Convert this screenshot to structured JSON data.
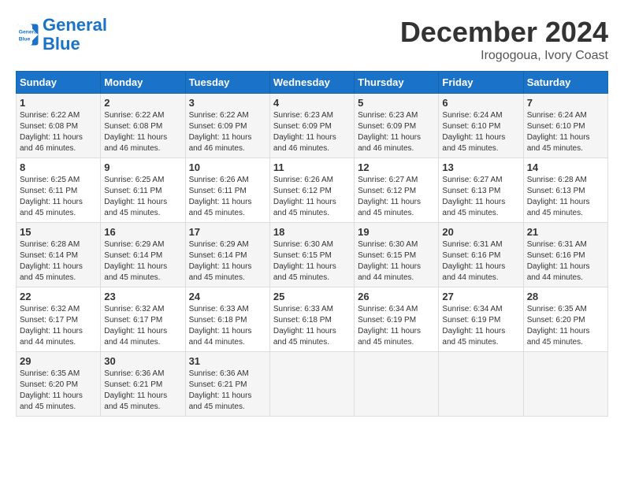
{
  "logo": {
    "line1": "General",
    "line2": "Blue"
  },
  "header": {
    "month": "December 2024",
    "location": "Irogogoua, Ivory Coast"
  },
  "weekdays": [
    "Sunday",
    "Monday",
    "Tuesday",
    "Wednesday",
    "Thursday",
    "Friday",
    "Saturday"
  ],
  "weeks": [
    [
      {
        "day": "1",
        "sunrise": "6:22 AM",
        "sunset": "6:08 PM",
        "daylight": "11 hours and 46 minutes."
      },
      {
        "day": "2",
        "sunrise": "6:22 AM",
        "sunset": "6:08 PM",
        "daylight": "11 hours and 46 minutes."
      },
      {
        "day": "3",
        "sunrise": "6:22 AM",
        "sunset": "6:09 PM",
        "daylight": "11 hours and 46 minutes."
      },
      {
        "day": "4",
        "sunrise": "6:23 AM",
        "sunset": "6:09 PM",
        "daylight": "11 hours and 46 minutes."
      },
      {
        "day": "5",
        "sunrise": "6:23 AM",
        "sunset": "6:09 PM",
        "daylight": "11 hours and 46 minutes."
      },
      {
        "day": "6",
        "sunrise": "6:24 AM",
        "sunset": "6:10 PM",
        "daylight": "11 hours and 45 minutes."
      },
      {
        "day": "7",
        "sunrise": "6:24 AM",
        "sunset": "6:10 PM",
        "daylight": "11 hours and 45 minutes."
      }
    ],
    [
      {
        "day": "8",
        "sunrise": "6:25 AM",
        "sunset": "6:11 PM",
        "daylight": "11 hours and 45 minutes."
      },
      {
        "day": "9",
        "sunrise": "6:25 AM",
        "sunset": "6:11 PM",
        "daylight": "11 hours and 45 minutes."
      },
      {
        "day": "10",
        "sunrise": "6:26 AM",
        "sunset": "6:11 PM",
        "daylight": "11 hours and 45 minutes."
      },
      {
        "day": "11",
        "sunrise": "6:26 AM",
        "sunset": "6:12 PM",
        "daylight": "11 hours and 45 minutes."
      },
      {
        "day": "12",
        "sunrise": "6:27 AM",
        "sunset": "6:12 PM",
        "daylight": "11 hours and 45 minutes."
      },
      {
        "day": "13",
        "sunrise": "6:27 AM",
        "sunset": "6:13 PM",
        "daylight": "11 hours and 45 minutes."
      },
      {
        "day": "14",
        "sunrise": "6:28 AM",
        "sunset": "6:13 PM",
        "daylight": "11 hours and 45 minutes."
      }
    ],
    [
      {
        "day": "15",
        "sunrise": "6:28 AM",
        "sunset": "6:14 PM",
        "daylight": "11 hours and 45 minutes."
      },
      {
        "day": "16",
        "sunrise": "6:29 AM",
        "sunset": "6:14 PM",
        "daylight": "11 hours and 45 minutes."
      },
      {
        "day": "17",
        "sunrise": "6:29 AM",
        "sunset": "6:14 PM",
        "daylight": "11 hours and 45 minutes."
      },
      {
        "day": "18",
        "sunrise": "6:30 AM",
        "sunset": "6:15 PM",
        "daylight": "11 hours and 45 minutes."
      },
      {
        "day": "19",
        "sunrise": "6:30 AM",
        "sunset": "6:15 PM",
        "daylight": "11 hours and 44 minutes."
      },
      {
        "day": "20",
        "sunrise": "6:31 AM",
        "sunset": "6:16 PM",
        "daylight": "11 hours and 44 minutes."
      },
      {
        "day": "21",
        "sunrise": "6:31 AM",
        "sunset": "6:16 PM",
        "daylight": "11 hours and 44 minutes."
      }
    ],
    [
      {
        "day": "22",
        "sunrise": "6:32 AM",
        "sunset": "6:17 PM",
        "daylight": "11 hours and 44 minutes."
      },
      {
        "day": "23",
        "sunrise": "6:32 AM",
        "sunset": "6:17 PM",
        "daylight": "11 hours and 44 minutes."
      },
      {
        "day": "24",
        "sunrise": "6:33 AM",
        "sunset": "6:18 PM",
        "daylight": "11 hours and 44 minutes."
      },
      {
        "day": "25",
        "sunrise": "6:33 AM",
        "sunset": "6:18 PM",
        "daylight": "11 hours and 45 minutes."
      },
      {
        "day": "26",
        "sunrise": "6:34 AM",
        "sunset": "6:19 PM",
        "daylight": "11 hours and 45 minutes."
      },
      {
        "day": "27",
        "sunrise": "6:34 AM",
        "sunset": "6:19 PM",
        "daylight": "11 hours and 45 minutes."
      },
      {
        "day": "28",
        "sunrise": "6:35 AM",
        "sunset": "6:20 PM",
        "daylight": "11 hours and 45 minutes."
      }
    ],
    [
      {
        "day": "29",
        "sunrise": "6:35 AM",
        "sunset": "6:20 PM",
        "daylight": "11 hours and 45 minutes."
      },
      {
        "day": "30",
        "sunrise": "6:36 AM",
        "sunset": "6:21 PM",
        "daylight": "11 hours and 45 minutes."
      },
      {
        "day": "31",
        "sunrise": "6:36 AM",
        "sunset": "6:21 PM",
        "daylight": "11 hours and 45 minutes."
      },
      null,
      null,
      null,
      null
    ]
  ],
  "labels": {
    "sunrise": "Sunrise:",
    "sunset": "Sunset:",
    "daylight": "Daylight:"
  }
}
